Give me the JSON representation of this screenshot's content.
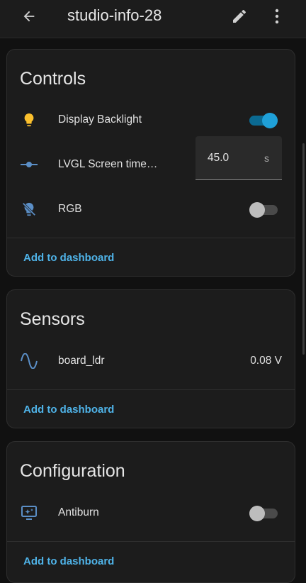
{
  "header": {
    "title": "studio-info-28",
    "back_icon": "arrow-left-icon",
    "edit_icon": "pencil-icon",
    "more_icon": "dots-vertical-icon"
  },
  "cards": {
    "controls": {
      "title": "Controls",
      "rows": [
        {
          "icon": "lightbulb-icon",
          "label": "Display Backlight",
          "state": "on"
        },
        {
          "icon": "slider-icon",
          "label": "LVGL Screen time…",
          "value": "45.0",
          "unit": "s"
        },
        {
          "icon": "lightbulb-off-icon",
          "label": "RGB",
          "state": "off"
        }
      ],
      "add_label": "Add to dashboard"
    },
    "sensors": {
      "title": "Sensors",
      "rows": [
        {
          "icon": "sine-wave-icon",
          "label": "board_ldr",
          "value": "0.08 V"
        }
      ],
      "add_label": "Add to dashboard"
    },
    "configuration": {
      "title": "Configuration",
      "rows": [
        {
          "icon": "monitor-sparkle-icon",
          "label": "Antiburn",
          "state": "off"
        }
      ],
      "add_label": "Add to dashboard"
    }
  },
  "colors": {
    "accent": "#4fb3e8",
    "toggle_on": "#1fa0d8",
    "icon_blue": "#5b8fc7",
    "icon_yellow": "#fbc02d"
  }
}
